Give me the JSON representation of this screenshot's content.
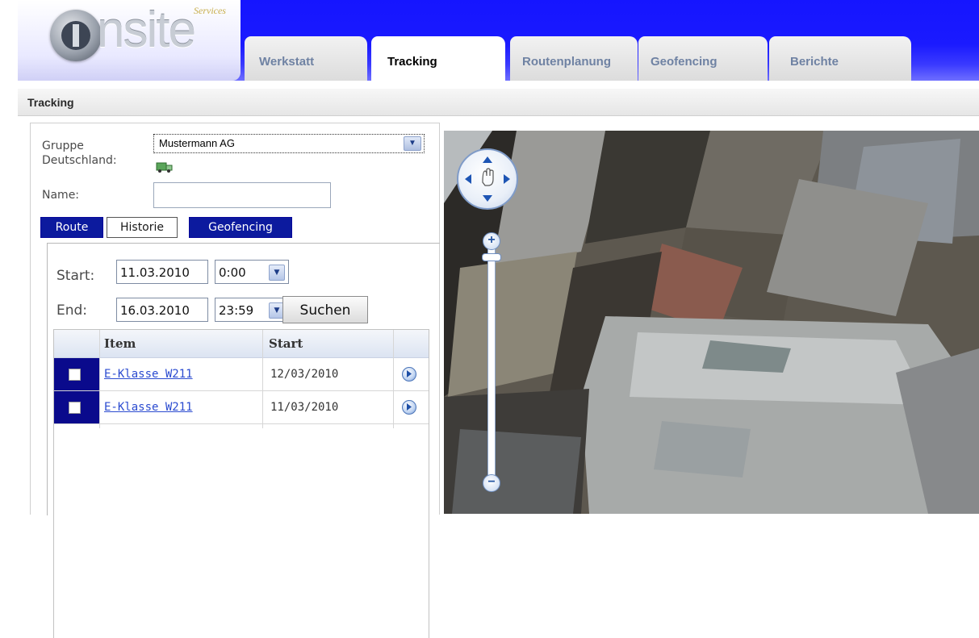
{
  "logo": {
    "text": "nsite",
    "services": "Services"
  },
  "tabs": [
    {
      "label": "Werkstatt"
    },
    {
      "label": "Tracking"
    },
    {
      "label": "Routenplanung"
    },
    {
      "label": "Geofencing"
    },
    {
      "label": "Berichte"
    }
  ],
  "breadcrumb": "Tracking",
  "form": {
    "group_label": "Gruppe",
    "group_value": "Mustermann AG",
    "region_label": "Deutschland:",
    "name_label": "Name:",
    "name_value": ""
  },
  "subtabs": [
    {
      "label": "Route"
    },
    {
      "label": "Historie"
    },
    {
      "label": "Geofencing"
    }
  ],
  "history": {
    "start_label": "Start:",
    "start_date": "11.03.2010",
    "start_time": "0:00",
    "end_label": "End:",
    "end_date": "16.03.2010",
    "end_time": "23:59",
    "search_label": "Suchen"
  },
  "table": {
    "headers": [
      "Item",
      "Start"
    ],
    "rows": [
      {
        "item": "E-Klasse W211",
        "start": "12/03/2010"
      },
      {
        "item": "E-Klasse W211",
        "start": "11/03/2010"
      }
    ]
  },
  "map": {
    "zoom_in": "+",
    "zoom_out": "−"
  },
  "colors": {
    "header_blue": "#1a1aff",
    "selected_row": "#0a0a8c",
    "link": "#2b4bd0"
  }
}
